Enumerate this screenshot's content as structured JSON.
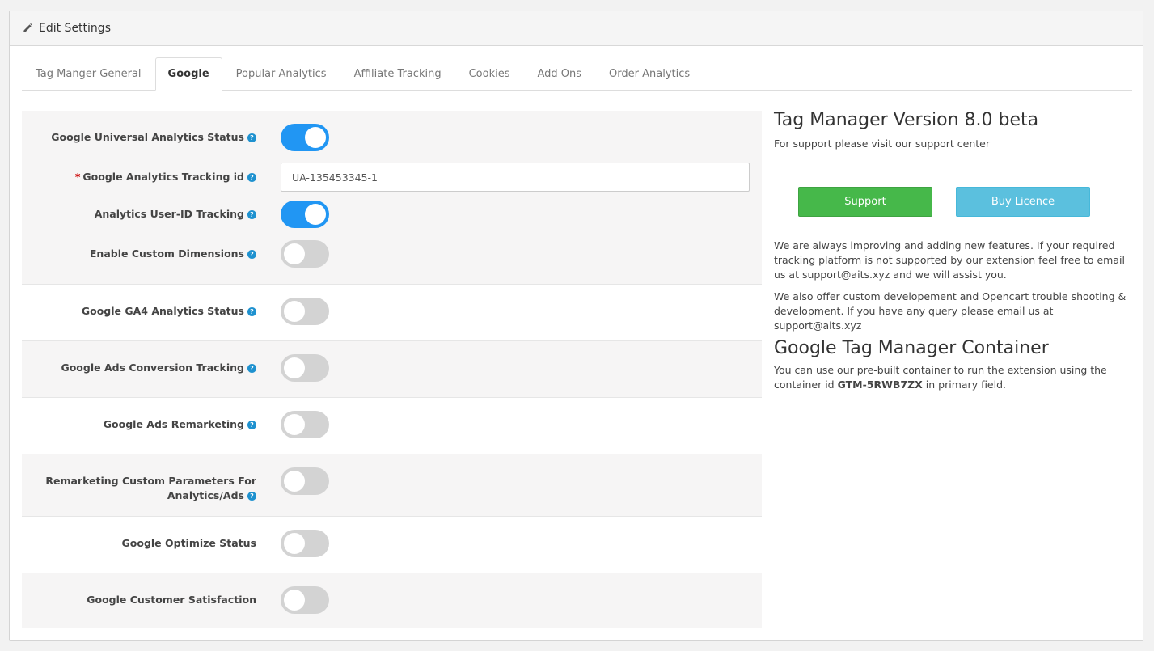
{
  "heading": {
    "title": "Edit Settings",
    "icon": "pencil-icon"
  },
  "tabs": [
    {
      "label": "Tag Manger General",
      "active": false
    },
    {
      "label": "Google",
      "active": true
    },
    {
      "label": "Popular Analytics",
      "active": false
    },
    {
      "label": "Affiliate Tracking",
      "active": false
    },
    {
      "label": "Cookies",
      "active": false
    },
    {
      "label": "Add Ons",
      "active": false
    },
    {
      "label": "Order Analytics",
      "active": false
    }
  ],
  "fields": {
    "ua_status": {
      "label": "Google Universal Analytics Status",
      "on": true
    },
    "tracking_id": {
      "label": "Google Analytics Tracking id",
      "required": true,
      "value": "UA-135453345-1"
    },
    "user_id": {
      "label": "Analytics User-ID Tracking",
      "on": true
    },
    "custom_dimensions": {
      "label": "Enable Custom Dimensions",
      "on": false
    },
    "ga4_status": {
      "label": "Google GA4 Analytics Status",
      "on": false
    },
    "ads_conversion": {
      "label": "Google Ads Conversion Tracking",
      "on": false
    },
    "ads_remarketing": {
      "label": "Google Ads Remarketing",
      "on": false
    },
    "remarketing_params": {
      "label_line1": "Remarketing Custom Parameters For",
      "label_line2": "Analytics/Ads",
      "on": false
    },
    "optimize_status": {
      "label": "Google Optimize Status",
      "on": false
    },
    "customer_satisfaction": {
      "label": "Google Customer Satisfaction",
      "on": false
    }
  },
  "help_glyph": "?",
  "required_glyph": "*",
  "side": {
    "version_title": "Tag Manager Version 8.0 beta",
    "support_text": "For support please visit our support center",
    "support_button": "Support",
    "buy_button": "Buy Licence",
    "para1": "We are always improving and adding new features. If your required tracking platform is not supported by our extension feel free to email us at support@aits.xyz and we will assist you.",
    "para2": "We also offer custom developement and Opencart trouble shooting & development. If you have any query please email us at support@aits.xyz",
    "container_title": "Google Tag Manager Container",
    "container_text_before": "You can use our pre-built container to run the extension using the container id ",
    "container_id": "GTM-5RWB7ZX",
    "container_text_after": " in primary field."
  },
  "colors": {
    "toggle_on": "#2196f3",
    "toggle_off": "#d3d3d3",
    "support_button": "#46b84a",
    "buy_button": "#5bc0de",
    "help_icon": "#1e91cf"
  }
}
